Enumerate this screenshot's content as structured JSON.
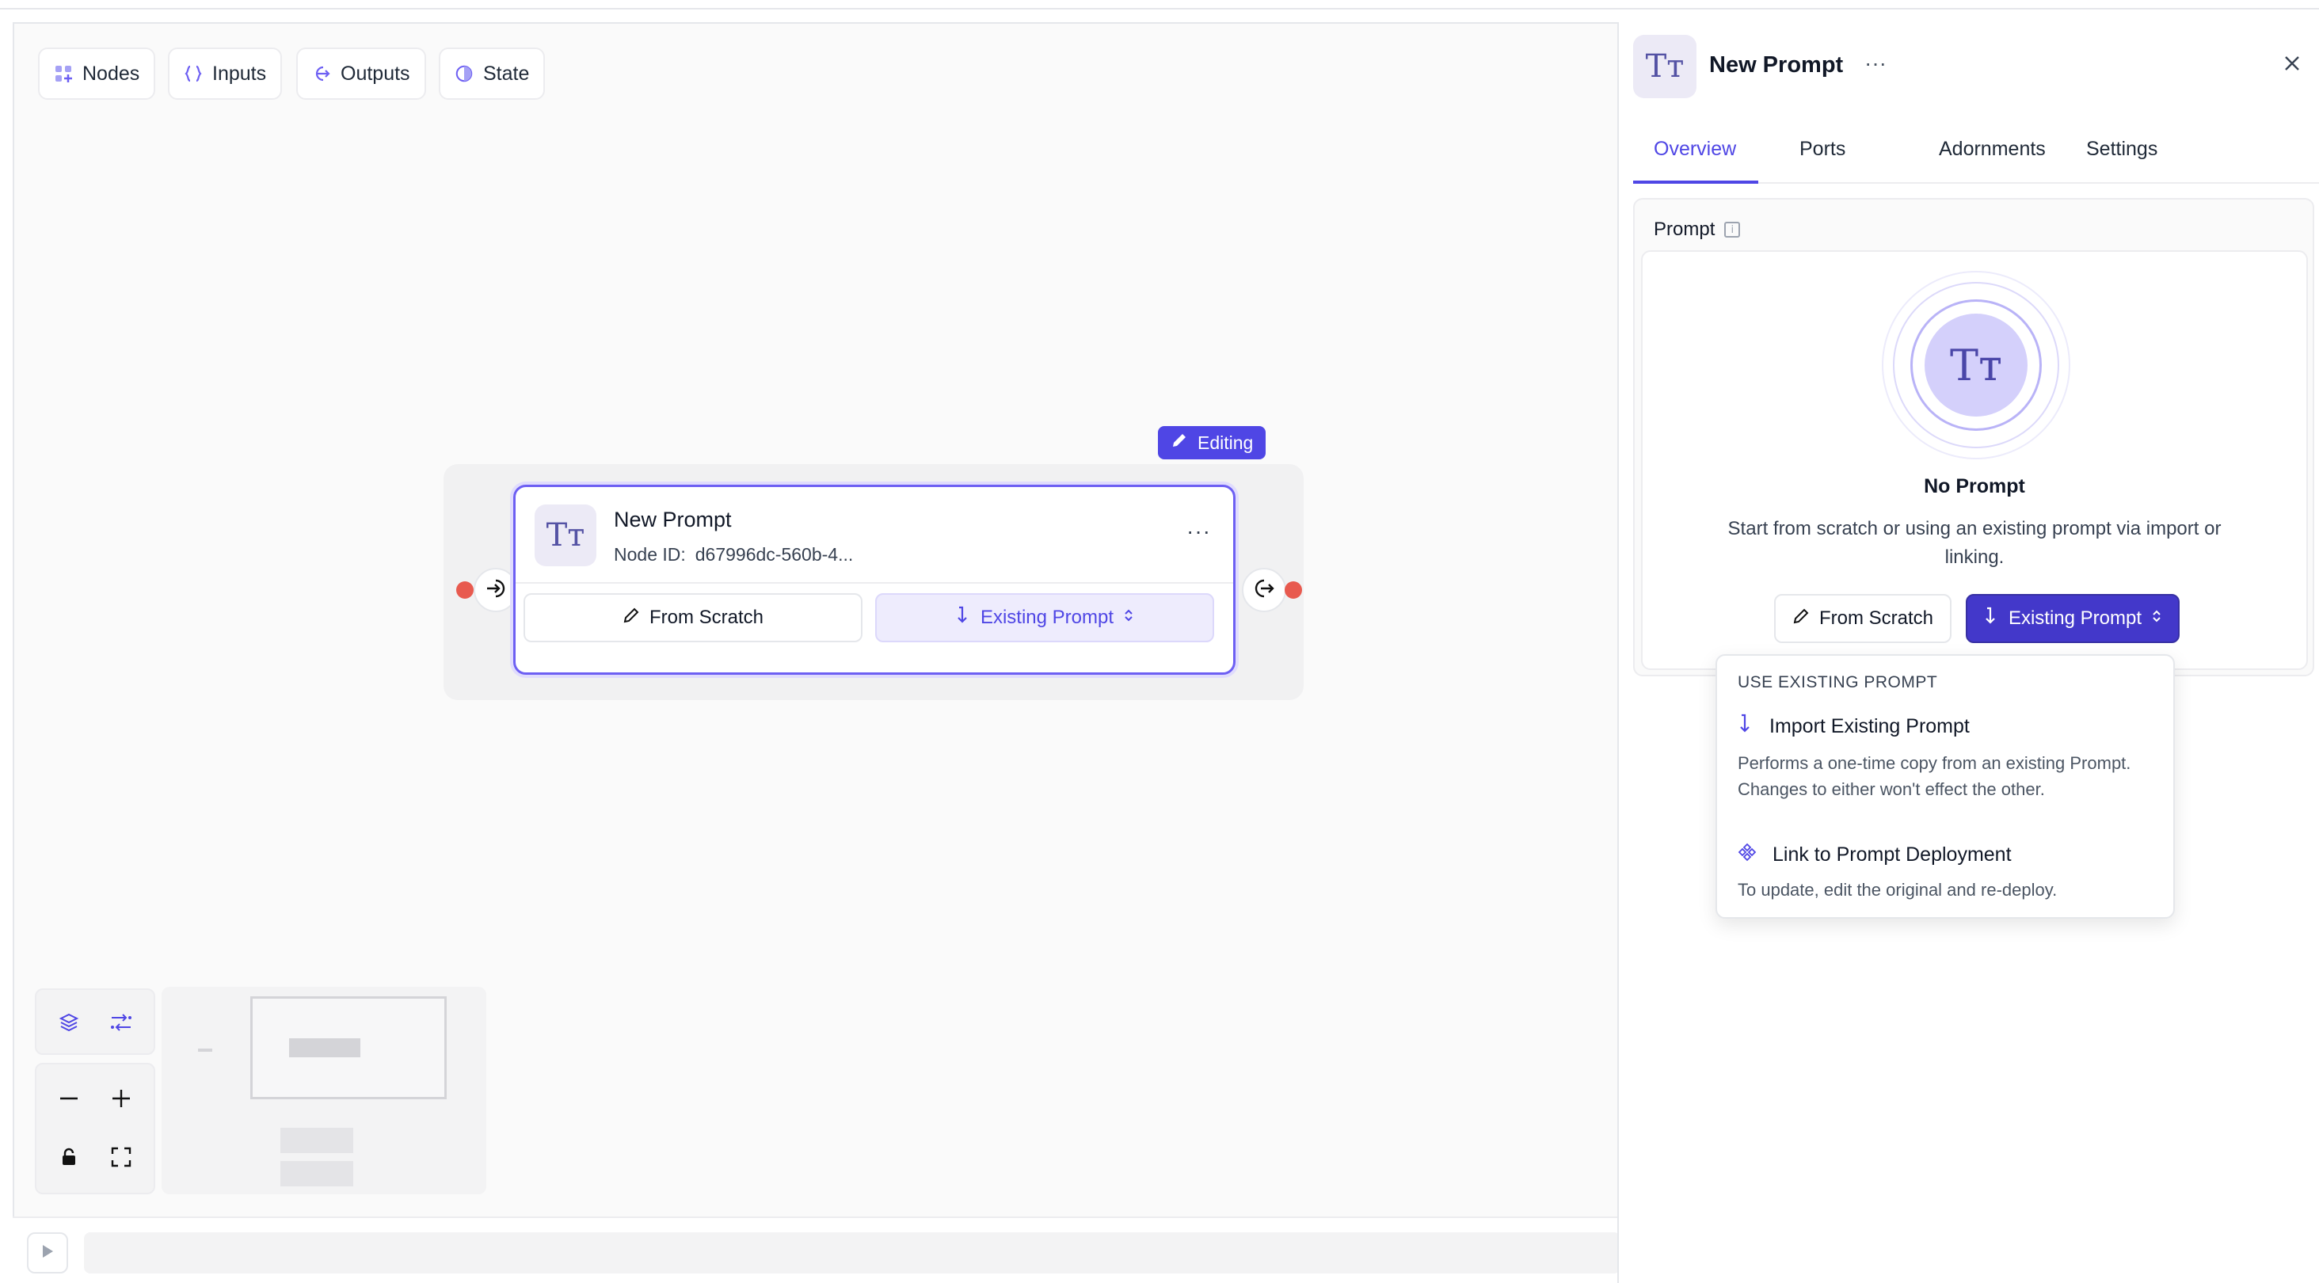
{
  "toolbar": {
    "nodes": {
      "label": "Nodes",
      "icon": "grid-plus-icon"
    },
    "inputs": {
      "label": "Inputs",
      "icon": "braces-icon"
    },
    "outputs": {
      "label": "Outputs",
      "icon": "arrow-right-circle-icon"
    },
    "state": {
      "label": "State",
      "icon": "state-circle-icon"
    }
  },
  "node": {
    "badge": "Editing",
    "title": "New Prompt",
    "id_label": "Node ID:",
    "id_value": "d67996dc-560b-4...",
    "avatar_text": "Tт",
    "scratch_label": "From Scratch",
    "existing_label": "Existing Prompt"
  },
  "panel": {
    "avatar_text": "Tт",
    "title": "New Prompt",
    "tabs": [
      {
        "label": "Overview",
        "active": true
      },
      {
        "label": "Ports",
        "active": false
      },
      {
        "label": "Adornments",
        "active": false
      },
      {
        "label": "Settings",
        "active": false
      }
    ],
    "prompt_label": "Prompt",
    "empty_avatar_text": "Tт",
    "empty_title": "No Prompt",
    "empty_desc": "Start from scratch or using an existing prompt via import or linking.",
    "scratch_label": "From Scratch",
    "existing_label": "Existing Prompt"
  },
  "dropdown": {
    "heading": "USE EXISTING PROMPT",
    "items": [
      {
        "title": "Import Existing Prompt",
        "desc": "Performs a one-time copy from an existing Prompt. Changes to either won't effect the other.",
        "icon": "import-arrow-icon"
      },
      {
        "title": "Link to Prompt Deployment",
        "desc": "To update, edit the original and re-deploy.",
        "icon": "link-deployment-icon"
      }
    ]
  },
  "colors": {
    "accent": "#4f46e5",
    "port": "#e85a4f"
  }
}
